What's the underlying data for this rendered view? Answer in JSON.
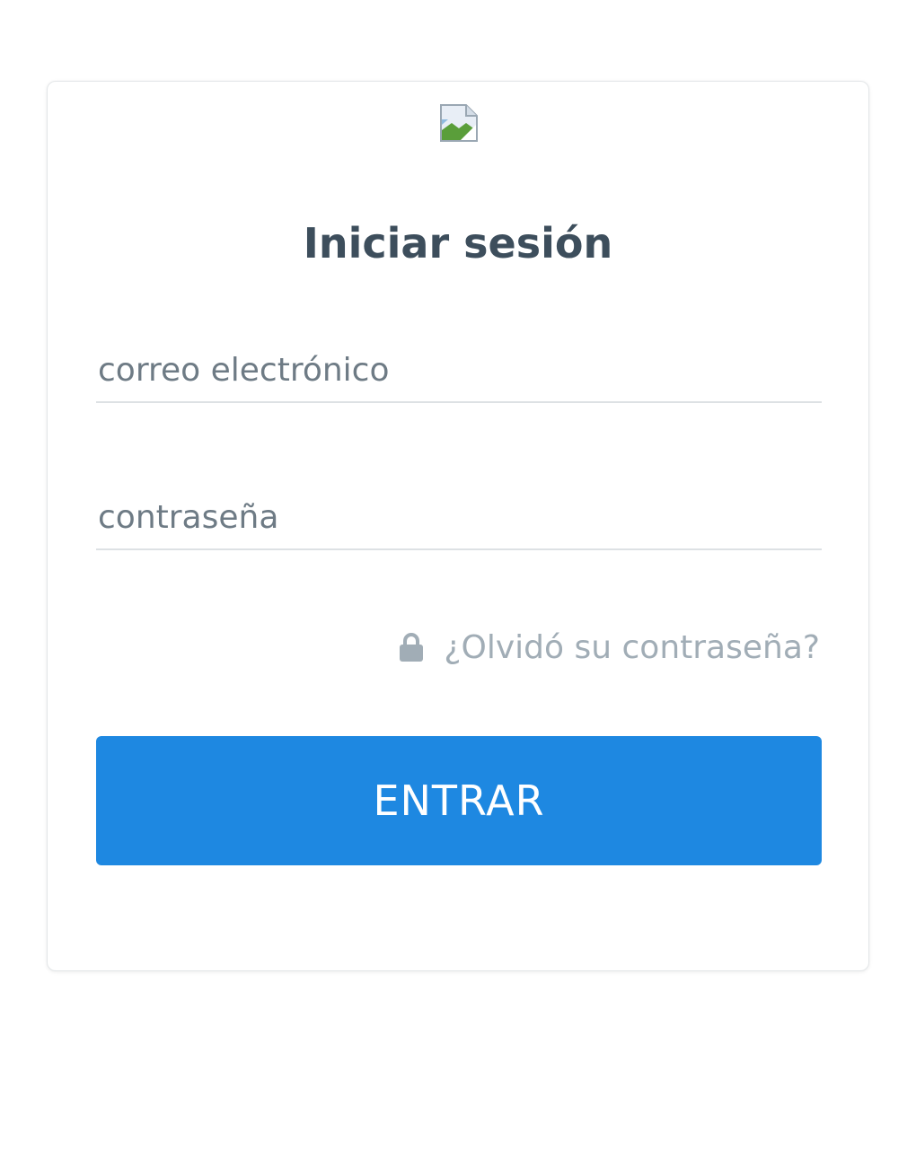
{
  "login": {
    "logo_icon": "broken-image-icon",
    "title": "Iniciar sesión",
    "email_placeholder": "correo electrónico",
    "password_placeholder": "contraseña",
    "forgot_icon": "lock-icon",
    "forgot_label": "¿Olvidó su contraseña?",
    "submit_label": "ENTRAR"
  },
  "colors": {
    "accent": "#1e88e1",
    "title": "#3d4e5c",
    "link": "#a1adb6",
    "underline": "#dde1e4"
  }
}
